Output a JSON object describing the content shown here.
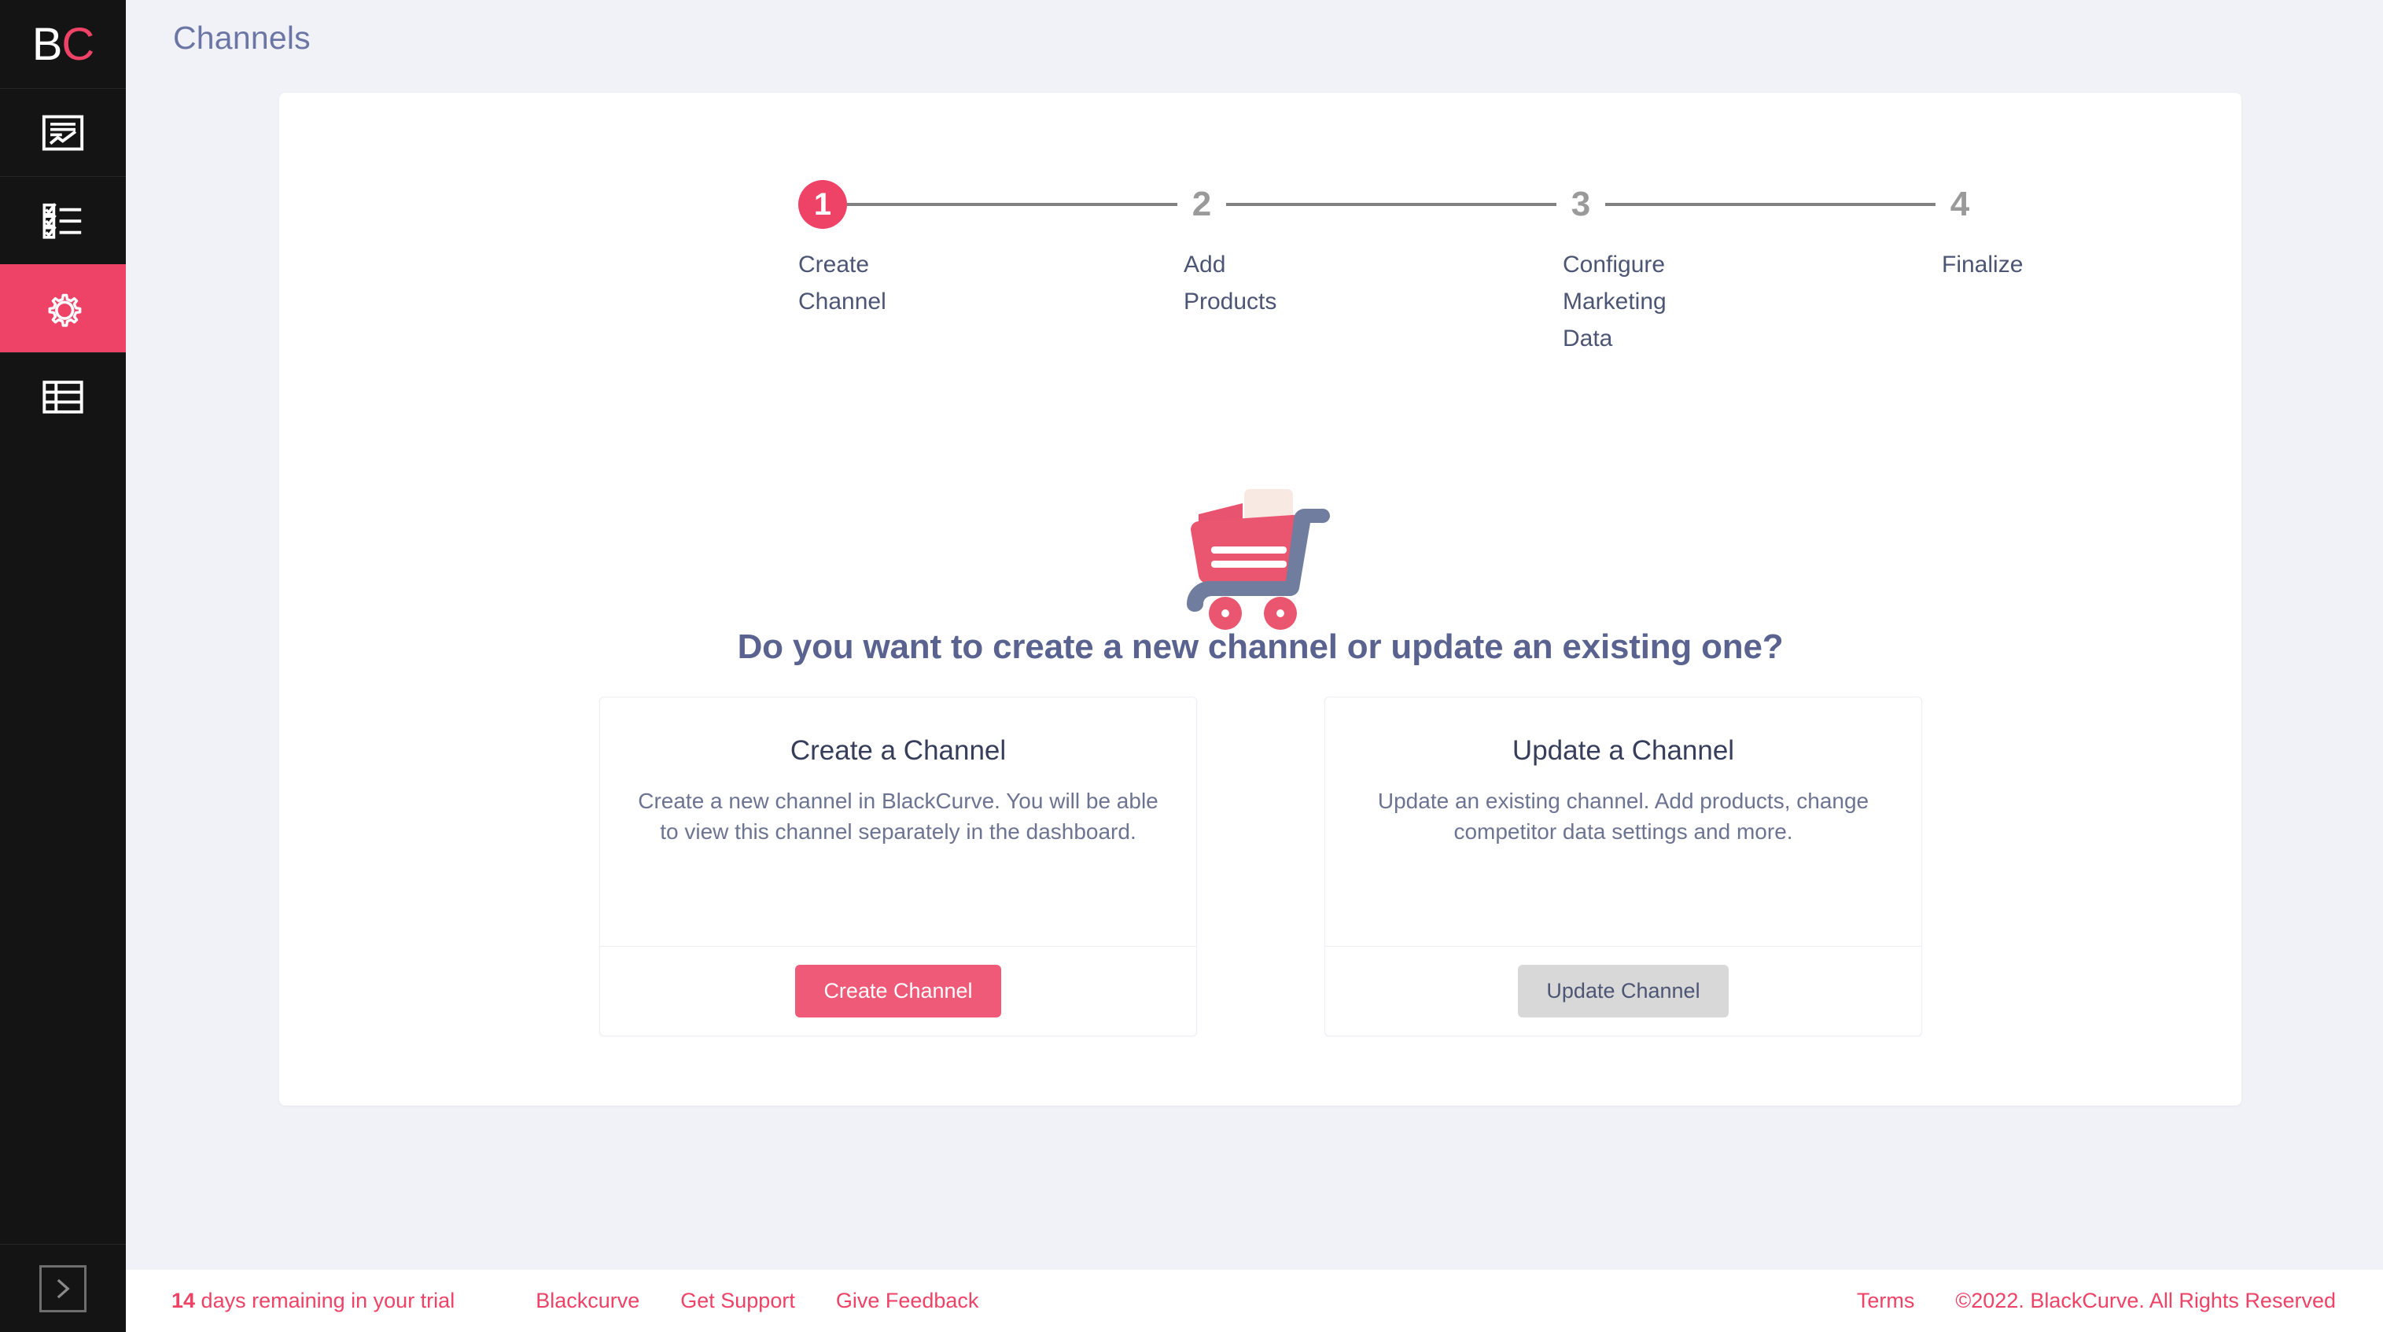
{
  "brand": {
    "logo_first": "B",
    "logo_second": "C",
    "accent_color": "#ee4266",
    "accent_button_color": "#ee5a77",
    "sidebar_color": "#141414",
    "page_bg_color": "#f1f2f7",
    "heading_color": "#5a638f"
  },
  "sidebar": {
    "items": [
      {
        "icon": "report-chart-icon",
        "active": false
      },
      {
        "icon": "checklist-icon",
        "active": false
      },
      {
        "icon": "gear-icon",
        "active": true
      },
      {
        "icon": "table-grid-icon",
        "active": false
      }
    ],
    "collapse_icon": "chevron-right-icon"
  },
  "header": {
    "title": "Channels"
  },
  "stepper": {
    "current_step": 1,
    "steps": [
      {
        "number": "1",
        "label": "Create Channel",
        "state": "active"
      },
      {
        "number": "2",
        "label": "Add Products",
        "state": "inactive"
      },
      {
        "number": "3",
        "label": "Configure Marketing Data",
        "state": "inactive"
      },
      {
        "number": "4",
        "label": "Finalize",
        "state": "inactive"
      }
    ]
  },
  "illustration": {
    "name": "shopping-cart-illustration"
  },
  "main": {
    "question": "Do you want to create a new channel or update an existing one?",
    "cards": [
      {
        "title": "Create a Channel",
        "description": "Create a new channel in BlackCurve. You will be able to view this channel separately in the dashboard.",
        "button_label": "Create Channel",
        "button_state": "enabled"
      },
      {
        "title": "Update a Channel",
        "description": "Update an existing channel. Add products, change competitor data settings and more.",
        "button_label": "Update Channel",
        "button_state": "disabled"
      }
    ]
  },
  "footer": {
    "trial_days": "14",
    "trial_text": " days remaining in your trial",
    "links": [
      "Blackcurve",
      "Get Support",
      "Give Feedback"
    ],
    "terms_label": "Terms",
    "copyright": "©2022. BlackCurve. All Rights Reserved"
  }
}
